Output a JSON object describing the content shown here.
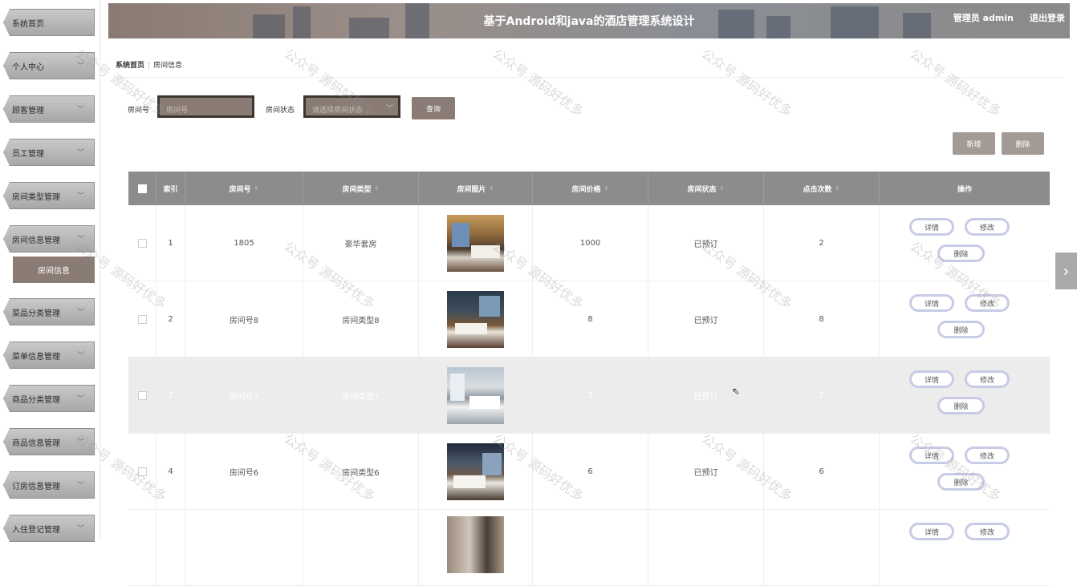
{
  "sidebar": {
    "items": [
      {
        "label": "系统首页",
        "has_chevron": false
      },
      {
        "label": "个人中心",
        "has_chevron": true
      },
      {
        "label": "顾客管理",
        "has_chevron": true
      },
      {
        "label": "员工管理",
        "has_chevron": true
      },
      {
        "label": "房间类型管理",
        "has_chevron": true
      },
      {
        "label": "房间信息管理",
        "has_chevron": true
      },
      {
        "label": "菜品分类管理",
        "has_chevron": true
      },
      {
        "label": "菜单信息管理",
        "has_chevron": true
      },
      {
        "label": "商品分类管理",
        "has_chevron": true
      },
      {
        "label": "商品信息管理",
        "has_chevron": true
      },
      {
        "label": "订房信息管理",
        "has_chevron": true
      },
      {
        "label": "入住登记管理",
        "has_chevron": true
      }
    ],
    "active_sub": "房间信息"
  },
  "header": {
    "title": "基于Android和java的酒店管理系统设计",
    "user": "管理员 admin",
    "logout": "退出登录"
  },
  "breadcrumb": {
    "home": "系统首页",
    "current": "房间信息"
  },
  "search": {
    "room_no_label": "房间号",
    "room_no_placeholder": "房间号",
    "status_label": "房间状态",
    "status_placeholder": "请选择房间状态",
    "query_button": "查询"
  },
  "actions": {
    "add": "新增",
    "delete": "删除"
  },
  "table": {
    "columns": [
      "索引",
      "房间号",
      "房间类型",
      "房间图片",
      "房间价格",
      "房间状态",
      "点击次数",
      "操作"
    ],
    "rows": [
      {
        "index": "1",
        "room_no": "1805",
        "room_type": "豪华套房",
        "price": "1000",
        "status": "已预订",
        "clicks": "2"
      },
      {
        "index": "2",
        "room_no": "房间号8",
        "room_type": "房间类型8",
        "price": "8",
        "status": "已预订",
        "clicks": "8"
      },
      {
        "index": "3",
        "room_no": "房间号7",
        "room_type": "房间类型7",
        "price": "7",
        "status": "已预订",
        "clicks": "7"
      },
      {
        "index": "4",
        "room_no": "房间号6",
        "room_type": "房间类型6",
        "price": "6",
        "status": "已预订",
        "clicks": "6"
      },
      {
        "index": "",
        "room_no": "",
        "room_type": "",
        "price": "",
        "status": "",
        "clicks": ""
      }
    ],
    "op_detail": "详情",
    "op_edit": "修改",
    "op_delete": "删除"
  },
  "watermark": "公众号 源码好优多",
  "colors": {
    "accent": "#8a7b74",
    "table_header": "#8c8c8c",
    "op_border": "#c8cbe6"
  }
}
